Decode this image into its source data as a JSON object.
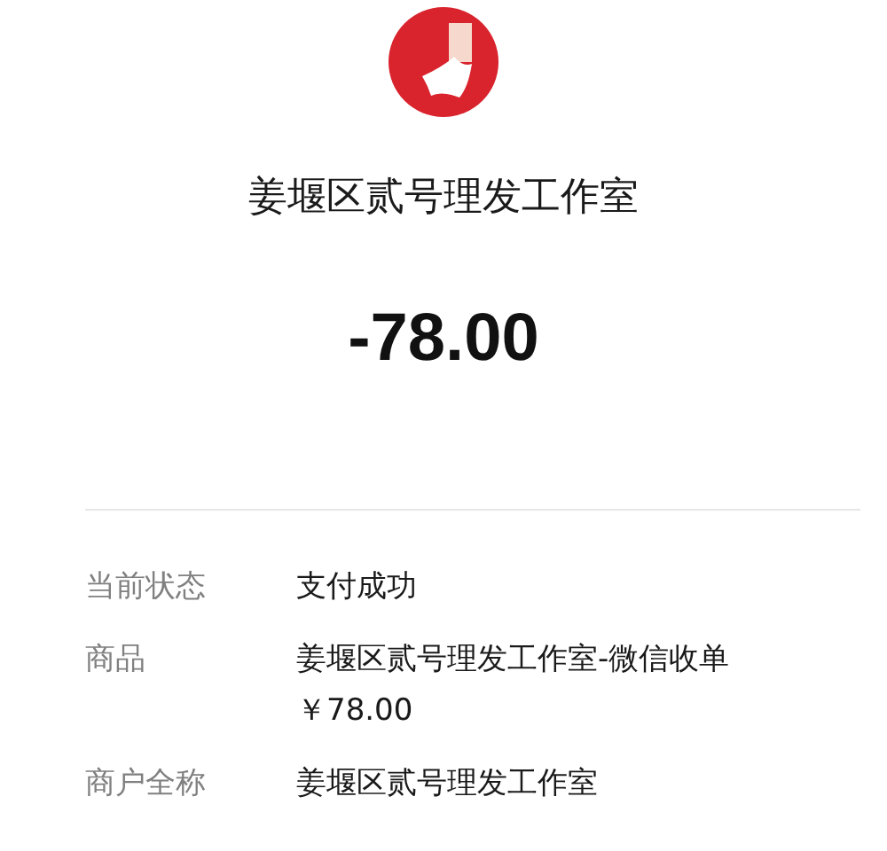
{
  "merchant": {
    "name": "姜堰区贰号理发工作室"
  },
  "amount": "-78.00",
  "details": [
    {
      "label": "当前状态",
      "lines": [
        "支付成功"
      ]
    },
    {
      "label": "商品",
      "lines": [
        "姜堰区贰号理发工作室-微信收单",
        "￥78.00"
      ]
    },
    {
      "label": "商户全称",
      "lines": [
        "姜堰区贰号理发工作室"
      ]
    }
  ]
}
